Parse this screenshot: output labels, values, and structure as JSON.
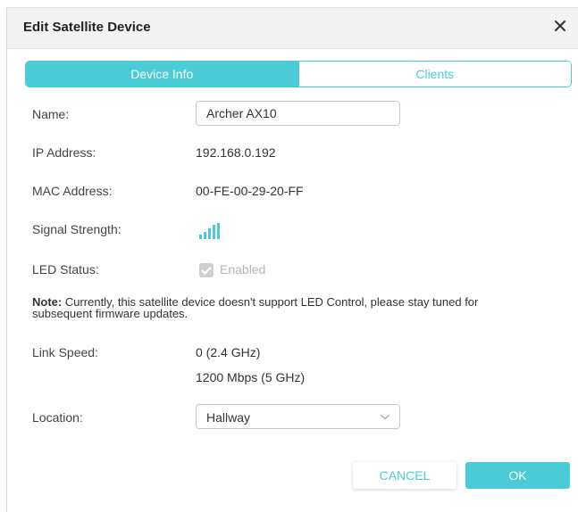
{
  "dialog": {
    "title": "Edit Satellite Device",
    "close_icon": "close-icon"
  },
  "tabs": [
    {
      "label": "Device Info",
      "active": true
    },
    {
      "label": "Clients",
      "active": false
    }
  ],
  "fields": {
    "name": {
      "label": "Name:",
      "value": "Archer AX10"
    },
    "ip": {
      "label": "IP Address:",
      "value": "192.168.0.192"
    },
    "mac": {
      "label": "MAC Address:",
      "value": "00-FE-00-29-20-FF"
    },
    "signal": {
      "label": "Signal Strength:",
      "icon": "signal-bars-icon"
    },
    "led": {
      "label": "LED Status:",
      "checkbox_label": "Enabled",
      "checked": true,
      "disabled": true
    },
    "note": {
      "bold": "Note:",
      "text": " Currently, this satellite device doesn't support LED Control, please stay tuned for subsequent firmware updates."
    },
    "link_speed": {
      "label": "Link Speed:",
      "values": [
        "0 (2.4 GHz)",
        "1200 Mbps (5 GHz)"
      ]
    },
    "location": {
      "label": "Location:",
      "value": "Hallway"
    }
  },
  "buttons": {
    "cancel": "CANCEL",
    "ok": "OK"
  },
  "colors": {
    "accent": "#4acbd6",
    "header_bg": "#f3f3f3",
    "disabled_text": "#b5b5b5"
  }
}
